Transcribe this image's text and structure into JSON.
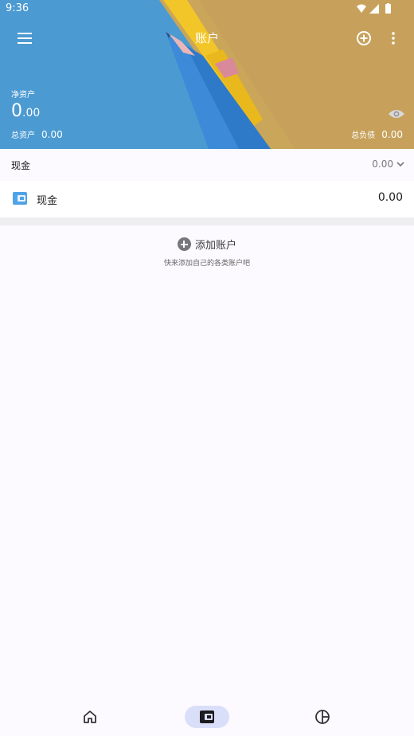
{
  "status_bar": {
    "time": "9:36"
  },
  "app_bar": {
    "title": "账户"
  },
  "summary": {
    "net_label": "净资产",
    "net_int": "0",
    "net_dec": ".00",
    "total_assets_label": "总资产",
    "total_assets": "0.00",
    "total_liabilities_label": "总负债",
    "total_liabilities": "0.00"
  },
  "groups": [
    {
      "name": "现金",
      "total": "0.00",
      "accounts": [
        {
          "name": "现金",
          "balance": "0.00"
        }
      ]
    }
  ],
  "add_account": {
    "label": "添加账户",
    "hint": "快来添加自己的各类账户吧"
  },
  "bottom_nav": {
    "active": "accounts",
    "active_color": "#d9dff8"
  },
  "colors": {
    "accent": "#d9dff8",
    "wallet_icon": "#4fa3e6",
    "background": "#fcfaff"
  }
}
